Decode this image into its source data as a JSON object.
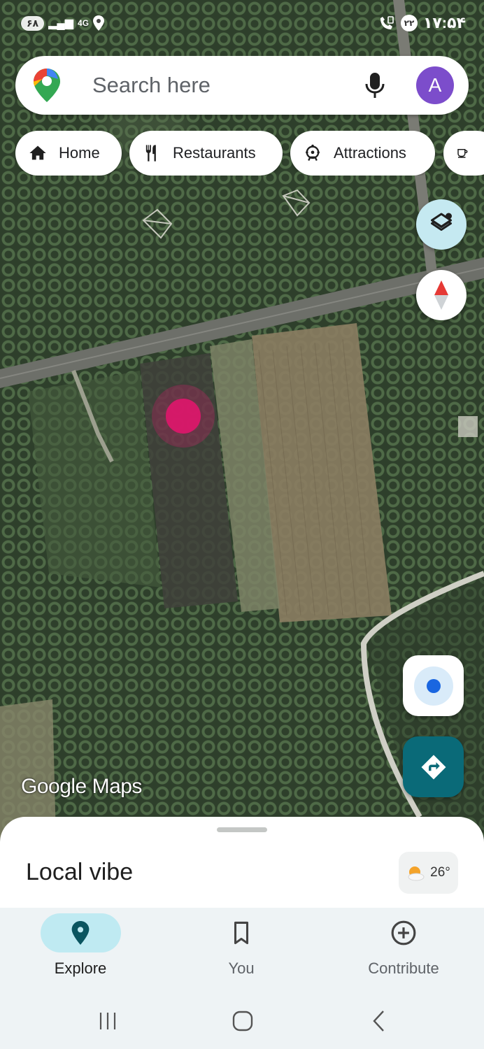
{
  "status_bar": {
    "battery": "۶۸",
    "network": "4G",
    "signal_icon": "signal-icon",
    "location_icon": "location-icon",
    "call_icon": "wifi-call-icon",
    "notification_count": "۲۲",
    "time": "۱۷:۵۴"
  },
  "search": {
    "placeholder": "Search here",
    "avatar_letter": "A"
  },
  "chips": [
    {
      "label": "Home",
      "icon": "home-icon"
    },
    {
      "label": "Restaurants",
      "icon": "restaurant-icon"
    },
    {
      "label": "Attractions",
      "icon": "attractions-icon"
    },
    {
      "label": "",
      "icon": "coffee-icon"
    }
  ],
  "map": {
    "watermark": "Google Maps"
  },
  "sheet": {
    "title": "Local vibe",
    "temperature": "26°",
    "weather_icon": "partly-cloudy-icon"
  },
  "nav": [
    {
      "label": "Explore",
      "icon": "explore-pin-icon",
      "active": true
    },
    {
      "label": "You",
      "icon": "bookmark-icon",
      "active": false
    },
    {
      "label": "Contribute",
      "icon": "add-circle-icon",
      "active": false
    }
  ],
  "colors": {
    "accent": "#0a6a78",
    "active_pill": "#bfeaf2",
    "avatar": "#7c4dcb",
    "location_dot": "#1a66e0"
  }
}
